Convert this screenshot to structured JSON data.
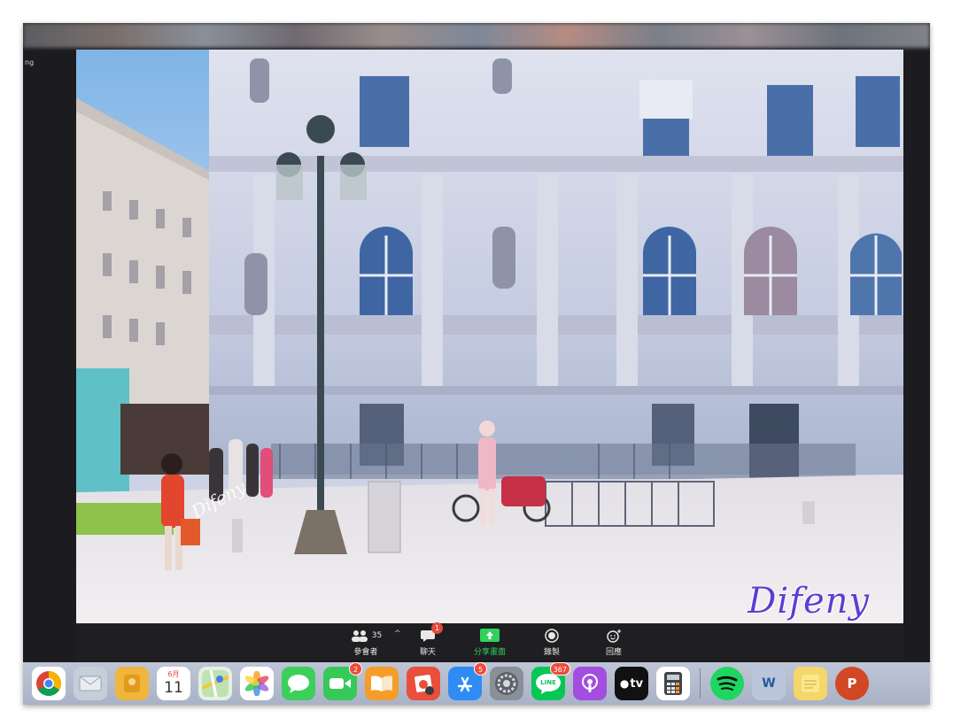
{
  "sidebar_fragment": "ng",
  "video": {
    "watermark_main": "Difeny",
    "watermark_small": "Difeny"
  },
  "zoom_toolbar": {
    "participants": {
      "label": "參會者",
      "count": "35",
      "icon": "people-icon"
    },
    "chat": {
      "label": "聊天",
      "badge": "1",
      "icon": "chat-bubble-icon"
    },
    "share": {
      "label": "分享畫面",
      "icon": "share-screen-icon",
      "color": "#2ed25c"
    },
    "record": {
      "label": "錄製",
      "icon": "record-icon"
    },
    "reactions": {
      "label": "回應",
      "icon": "emoji-reaction-icon"
    }
  },
  "dock": {
    "calendar_month": "6月",
    "calendar_day": "11",
    "facetime_badge": "2",
    "appstore_badge": "5",
    "line_label": "LINE",
    "line_badge": "367",
    "appletv_label": "tv",
    "word_label": "W",
    "powerpoint_label": "P"
  }
}
